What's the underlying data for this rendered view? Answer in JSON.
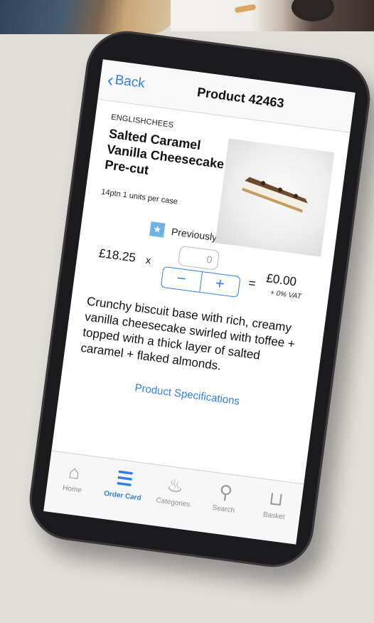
{
  "navbar": {
    "back_label": "Back",
    "title": "Product 42463"
  },
  "product": {
    "brand": "ENGLISHCHEES",
    "name": "Salted Caramel Vanilla Cheesecake Pre-cut",
    "pack_info": "14ptn  1 units per case",
    "purchased_label": "Previously purchased",
    "price": "£18.25",
    "times": "x",
    "quantity_placeholder": "0",
    "minus_label": "−",
    "plus_label": "+",
    "equals": "=",
    "total": "£0.00",
    "vat": "+ 0% VAT",
    "description": "Crunchy biscuit base with rich, creamy vanilla cheesecake swirled with toffee + topped with a thick layer of salted caramel + flaked almonds.",
    "specs_link": "Product Specifications"
  },
  "tabs": [
    {
      "label": "Home",
      "icon": "home-icon",
      "active": false
    },
    {
      "label": "Order Card",
      "icon": "order-card-icon",
      "active": true
    },
    {
      "label": "Categories",
      "icon": "categories-icon",
      "active": false
    },
    {
      "label": "Search",
      "icon": "search-icon",
      "active": false
    },
    {
      "label": "Basket",
      "icon": "basket-icon",
      "active": false
    }
  ],
  "colors": {
    "accent": "#2f7fe8",
    "badge": "#6fb3e6"
  }
}
